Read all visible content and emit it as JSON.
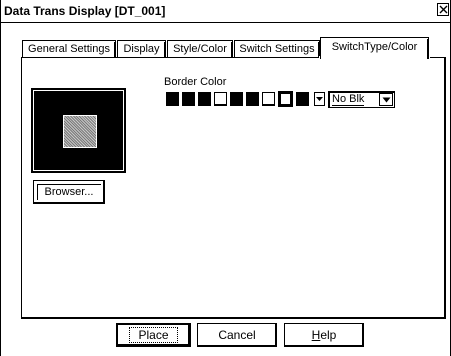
{
  "window": {
    "title": "Data Trans Display [DT_001]"
  },
  "tabs": [
    {
      "label": "General Settings",
      "active": false
    },
    {
      "label": "Display",
      "active": false
    },
    {
      "label": "Style/Color",
      "active": false
    },
    {
      "label": "Switch Settings",
      "active": false
    },
    {
      "label": "SwitchType/Color",
      "active": true
    }
  ],
  "switch_type": {
    "browser_label": "Browser..."
  },
  "border_color": {
    "label": "Border Color",
    "swatches": [
      "filled",
      "filled",
      "filled",
      "open",
      "filled",
      "filled",
      "open",
      "selected",
      "filled"
    ],
    "color_value": "No Blk"
  },
  "buttons": {
    "place": "Place",
    "cancel": "Cancel",
    "help_prefix": "",
    "help_underlined": "H",
    "help_rest": "elp"
  }
}
